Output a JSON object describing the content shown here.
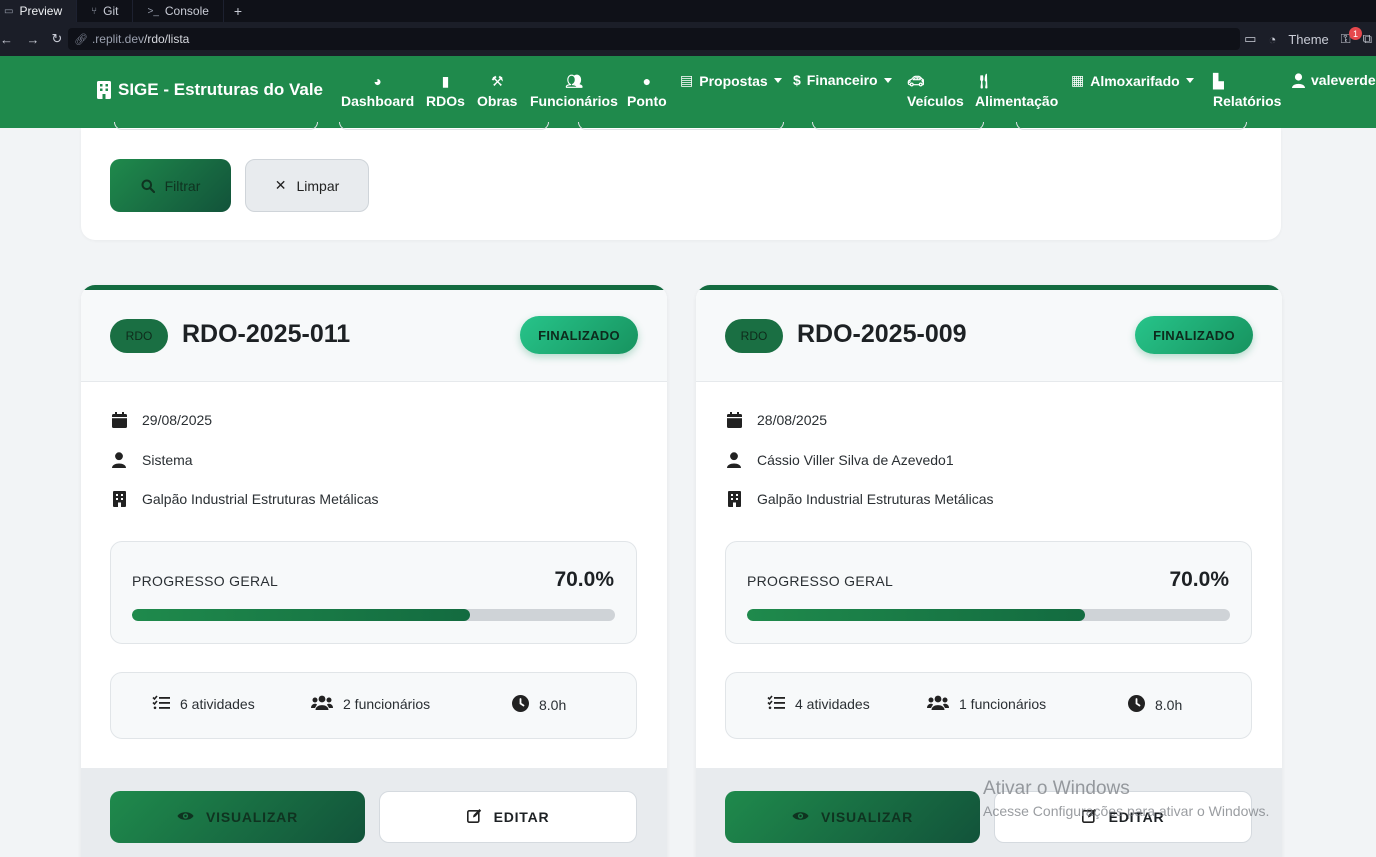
{
  "ide": {
    "tabs": [
      {
        "label": "Preview"
      },
      {
        "label": "Git"
      },
      {
        "label": "Console"
      }
    ],
    "url_prefix": ".replit.dev",
    "url_path": "/rdo/lista",
    "theme_label": "Theme",
    "notification_count": "1"
  },
  "navbar": {
    "brand": "SIGE - Estruturas do Vale",
    "items": {
      "dashboard": "Dashboard",
      "rdos": "RDOs",
      "obras": "Obras",
      "funcionarios": "Funcionários",
      "ponto": "Ponto",
      "propostas": "Propostas",
      "financeiro": "Financeiro",
      "veiculos": "Veículos",
      "alimentacao": "Alimentação",
      "almoxarifado": "Almoxarifado",
      "relatorios": "Relatórios",
      "user": "valeverde"
    }
  },
  "filters": {
    "filter_label": "Filtrar",
    "clear_label": "Limpar"
  },
  "cards": [
    {
      "tag": "RDO",
      "code": "RDO-2025-011",
      "status": "FINALIZADO",
      "date": "29/08/2025",
      "author": "Sistema",
      "site": "Galpão Industrial Estruturas Metálicas",
      "progress_label": "PROGRESSO GERAL",
      "progress_text": "70.0%",
      "progress_value": 70.0,
      "activities": "6 atividades",
      "employees": "2 funcionários",
      "hours": "8.0h",
      "view_label": "VISUALIZAR",
      "edit_label": "EDITAR"
    },
    {
      "tag": "RDO",
      "code": "RDO-2025-009",
      "status": "FINALIZADO",
      "date": "28/08/2025",
      "author": "Cássio Viller Silva de Azevedo1",
      "site": "Galpão Industrial Estruturas Metálicas",
      "progress_label": "PROGRESSO GERAL",
      "progress_text": "70.0%",
      "progress_value": 70.0,
      "activities": "4 atividades",
      "employees": "1 funcionários",
      "hours": "8.0h",
      "view_label": "VISUALIZAR",
      "edit_label": "EDITAR"
    }
  ],
  "watermark": {
    "title": "Ativar o Windows",
    "subtitle": "Acesse Configurações para ativar o Windows."
  },
  "colors": {
    "navbar": "#1f8a4c",
    "primary_dark": "#136b40",
    "status": "#27c48a"
  },
  "icons": [
    "monitor-icon",
    "git-icon",
    "terminal-icon",
    "plus-icon",
    "back-icon",
    "forward-icon",
    "refresh-icon",
    "link-icon",
    "chat-icon",
    "palette-icon",
    "building-icon",
    "gauge-icon",
    "clipboard-icon",
    "hammer-icon",
    "users-icon",
    "clock-icon",
    "file-icon",
    "dollar-icon",
    "car-icon",
    "utensils-icon",
    "boxes-icon",
    "chart-icon",
    "user-icon",
    "search-icon",
    "close-icon",
    "calendar-icon",
    "list-check-icon",
    "eye-icon",
    "edit-icon"
  ]
}
